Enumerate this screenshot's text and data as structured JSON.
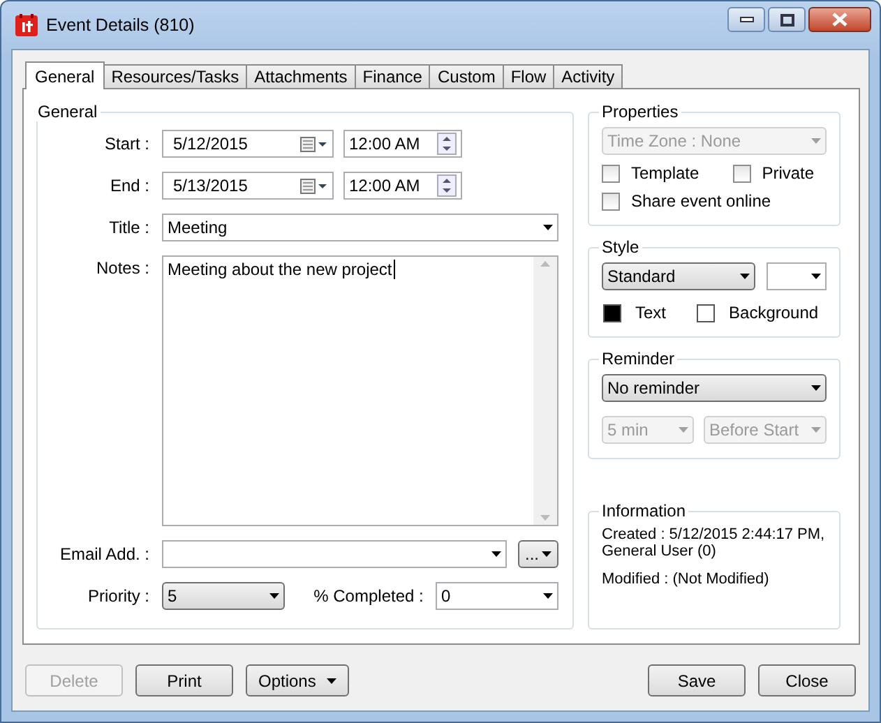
{
  "window": {
    "title": "Event Details (810)"
  },
  "tabs": [
    {
      "label": "General",
      "selected": true
    },
    {
      "label": "Resources/Tasks",
      "selected": false
    },
    {
      "label": "Attachments",
      "selected": false
    },
    {
      "label": "Finance",
      "selected": false
    },
    {
      "label": "Custom",
      "selected": false
    },
    {
      "label": "Flow",
      "selected": false
    },
    {
      "label": "Activity",
      "selected": false
    }
  ],
  "general": {
    "title": "General",
    "start": {
      "label": "Start :",
      "date": "5/12/2015",
      "time": "12:00 AM"
    },
    "end": {
      "label": "End  :",
      "date": "5/13/2015",
      "time": "12:00 AM"
    },
    "event_title": {
      "label": "Title :",
      "value": "Meeting"
    },
    "notes": {
      "label": "Notes :",
      "value": "Meeting about the new project"
    },
    "email": {
      "label": "Email Add. :",
      "button": "..."
    },
    "priority": {
      "label": "Priority :",
      "value": "5"
    },
    "completed": {
      "label": "% Completed :",
      "value": "0"
    }
  },
  "properties": {
    "title": "Properties",
    "time_zone": {
      "value": "Time Zone : None",
      "disabled": true
    },
    "checkboxes": [
      {
        "label": "Template",
        "checked": false
      },
      {
        "label": "Private",
        "checked": false
      },
      {
        "label": "Share event online",
        "checked": false
      }
    ]
  },
  "style": {
    "title": "Style",
    "value": "Standard",
    "swatches": [
      {
        "label": "Text",
        "color": "#000000"
      },
      {
        "label": "Background",
        "color": "#ffffff"
      }
    ]
  },
  "reminder": {
    "title": "Reminder",
    "value": "No reminder",
    "amount": {
      "value": "5 min",
      "disabled": true
    },
    "relative": {
      "value": "Before Start",
      "disabled": true
    }
  },
  "information": {
    "title": "Information",
    "created": "Created : 5/12/2015 2:44:17 PM, General User (0)",
    "modified": "Modified : (Not Modified)"
  },
  "buttons_left": [
    {
      "label": "Delete",
      "disabled": true,
      "kind": "plain"
    },
    {
      "label": "Print",
      "disabled": false,
      "kind": "plain"
    },
    {
      "label": "Options",
      "disabled": false,
      "kind": "menu"
    }
  ],
  "buttons_right": [
    {
      "label": "Save",
      "disabled": false,
      "kind": "plain"
    },
    {
      "label": "Close",
      "disabled": false,
      "kind": "plain"
    }
  ]
}
